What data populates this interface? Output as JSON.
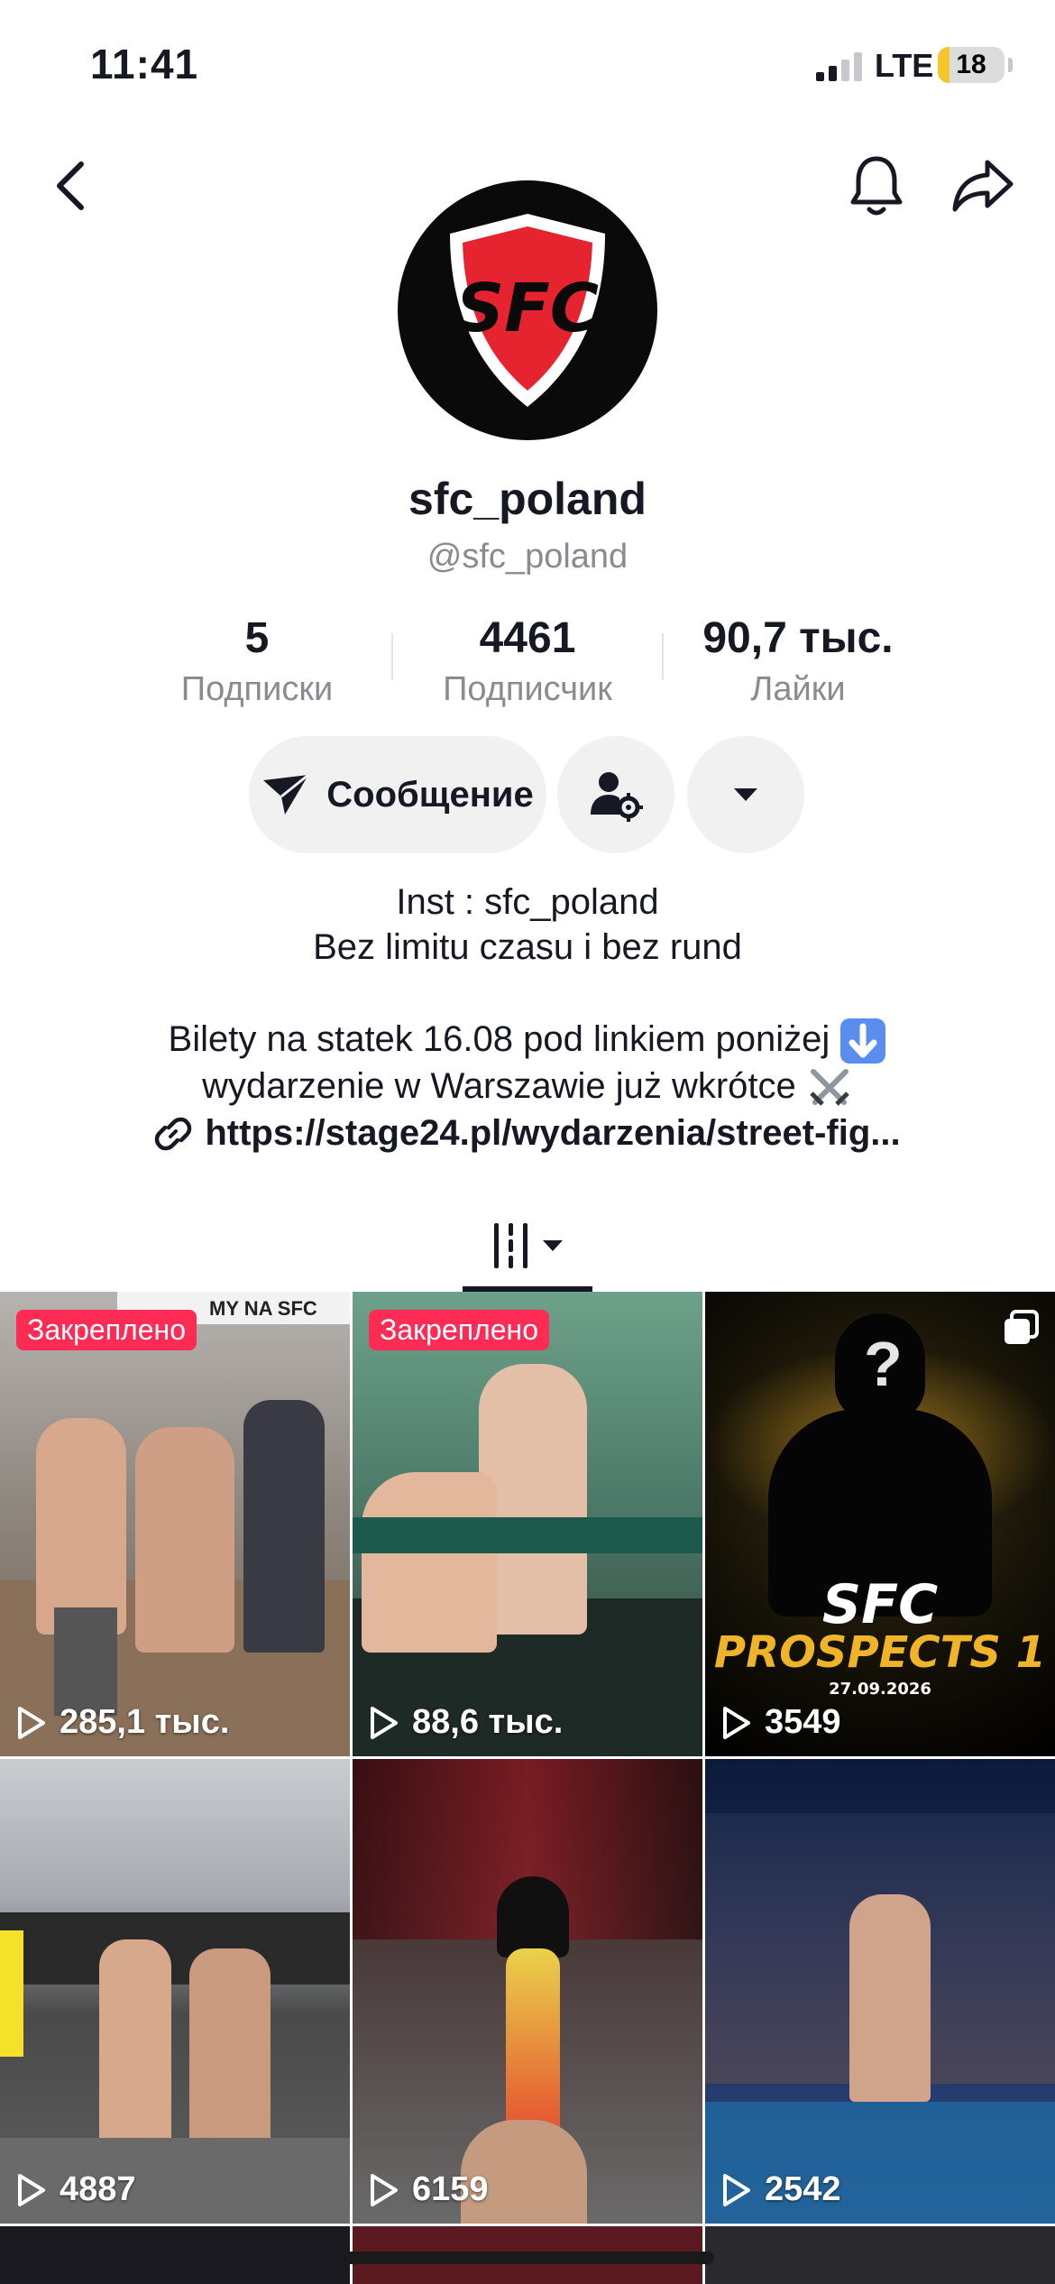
{
  "status_bar": {
    "time": "11:41",
    "network": "LTE",
    "battery": "18",
    "battery_level": 0.18
  },
  "profile": {
    "display_name": "sfc_poland",
    "handle": "@sfc_poland",
    "avatar_logo_text": "SFC",
    "stats": [
      {
        "value": "5",
        "label": "Подписки"
      },
      {
        "value": "4461",
        "label": "Подписчик"
      },
      {
        "value": "90,7 тыс.",
        "label": "Лайки"
      }
    ],
    "message_button": "Сообщение",
    "bio_lines": [
      "Inst : sfc_poland",
      "Bez limitu czasu i bez rund"
    ],
    "bio_promo_line1": "Bilety na statek 16.08 pod linkiem poniżej",
    "bio_promo_line2": "wydarzenie w Warszawie już wkrótce",
    "link": "https://stage24.pl/wydarzenia/street-fig..."
  },
  "grid": {
    "pinned_label": "Закреплено",
    "poster": {
      "title_line1": "SFC",
      "title_line2": "PROSPECTS 1",
      "date": "27.09.2026"
    },
    "video_overlay_text": "MY NA SFC",
    "videos": [
      {
        "views": "285,1 тыс.",
        "pinned": true
      },
      {
        "views": "88,6 тыс.",
        "pinned": true
      },
      {
        "views": "3549",
        "pinned": false
      },
      {
        "views": "4887",
        "pinned": false
      },
      {
        "views": "6159",
        "pinned": false
      },
      {
        "views": "2542",
        "pinned": false
      }
    ]
  },
  "colors": {
    "accent_red": "#fe2c55",
    "text_primary": "#161823",
    "text_secondary": "#8a8b91",
    "button_bg": "#f1f1f2"
  }
}
